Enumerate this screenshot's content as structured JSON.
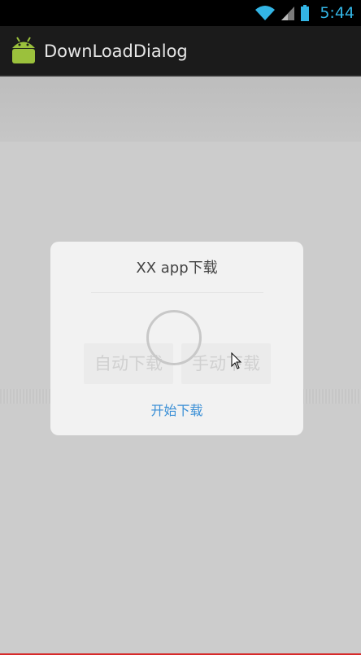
{
  "status_bar": {
    "time": "5:44",
    "icons": [
      "wifi-icon",
      "signal-icon",
      "battery-icon"
    ]
  },
  "action_bar": {
    "title": "DownLoadDialog",
    "icon": "android-app-icon"
  },
  "dialog": {
    "title": "XX app下载",
    "auto_download_label": "自动下载",
    "manual_download_label": "手动下载",
    "start_download_label": "开始下载"
  },
  "colors": {
    "accent": "#33b5e5",
    "link": "#3a8fd6",
    "action_bar_bg": "#1b1b1b",
    "background": "#cccccc"
  }
}
